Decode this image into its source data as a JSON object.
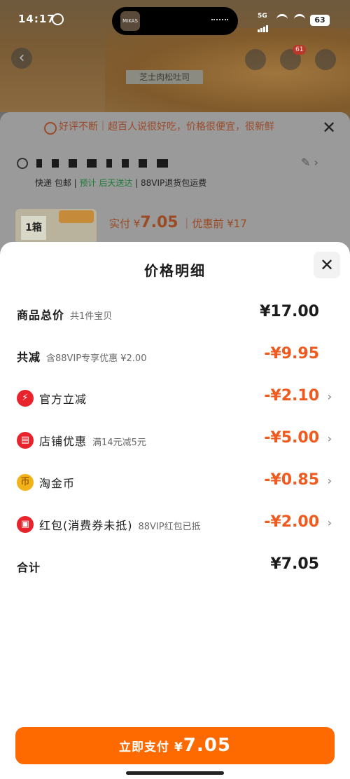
{
  "status_bar": {
    "time": "14:17",
    "network": "5G",
    "battery": "63"
  },
  "island": {
    "app_label": "MIKAS"
  },
  "background": {
    "cart_badge": "61",
    "product_label": "芝士肉松吐司",
    "promo_text": "好评不断｜超百人说很好吃，价格很便宜，很新鲜",
    "shipping_text": "快递 包邮",
    "shipping_highlight": "预计 后天送达",
    "shipping_extra": "88VIP退货包运费",
    "thumb_tag": "1箱",
    "pay_label": "实付 ¥",
    "pay_amount": "7.05",
    "pay_pre": "｜优惠前 ¥17"
  },
  "modal": {
    "title": "价格明细",
    "rows": [
      {
        "label": "商品总价",
        "note": "共1件宝贝",
        "amount": "¥17.00"
      },
      {
        "label": "共减",
        "note": "含88VIP专享优惠 ¥2.00",
        "amount": "-¥9.95"
      },
      {
        "label": "官方立减",
        "note": "",
        "amount": "-¥2.10"
      },
      {
        "label": "店铺优惠",
        "note": "满14元减5元",
        "amount": "-¥5.00"
      },
      {
        "label": "淘金币",
        "note": "",
        "amount": "-¥0.85"
      },
      {
        "label": "红包(消费券未抵)",
        "note": "88VIP红包已抵",
        "amount": "-¥2.00"
      },
      {
        "label": "合计",
        "note": "",
        "amount": "¥7.05"
      }
    ],
    "pay_button": {
      "label": "立即支付 ¥",
      "amount": "7.05"
    }
  },
  "icons": {
    "official": "lightning-icon",
    "shop": "shop-icon",
    "coin": "coin-icon",
    "redpacket": "red-packet-icon"
  },
  "colors": {
    "accent": "#fe6a00",
    "discount": "#f05a1e",
    "icon_red": "#e8232c",
    "icon_gold": "#f2b21a"
  }
}
